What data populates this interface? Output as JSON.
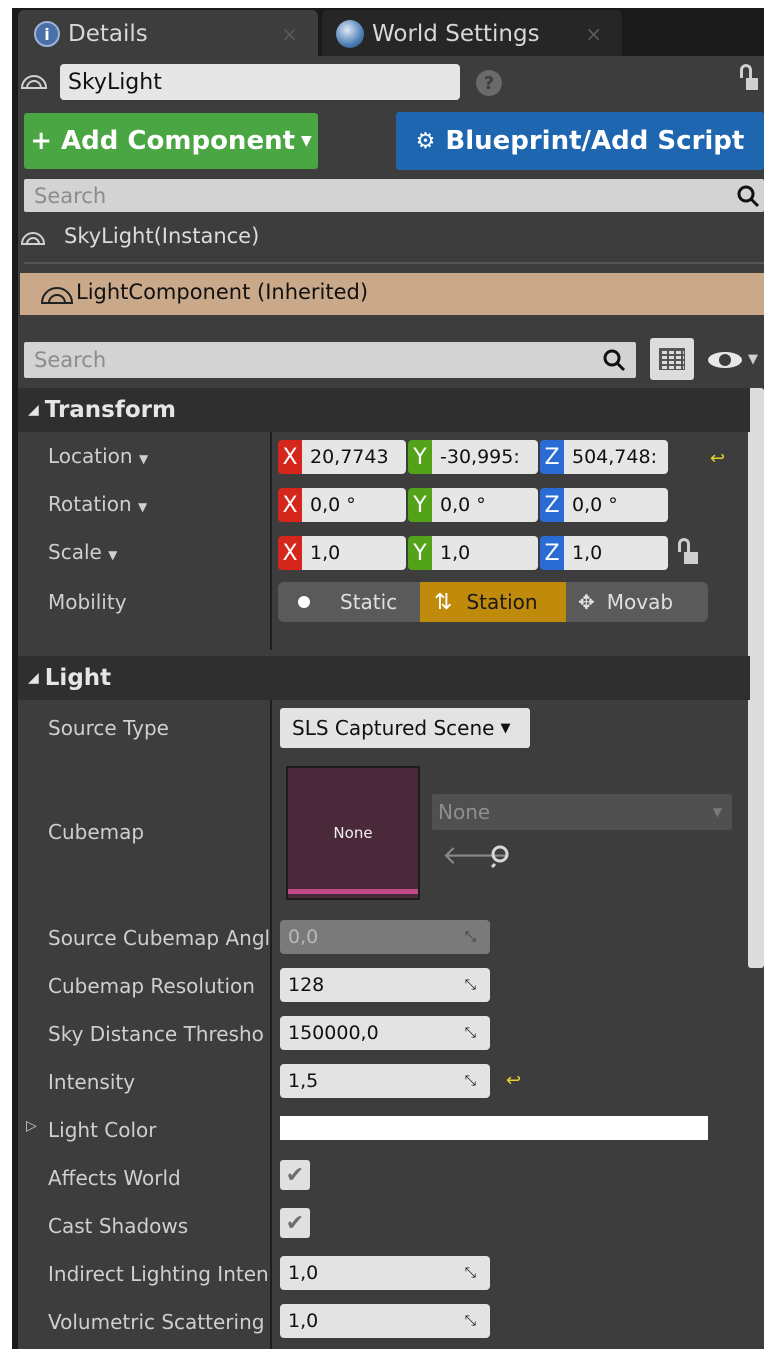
{
  "tabs": [
    {
      "label": "Details",
      "close": "×",
      "icon": "info-icon"
    },
    {
      "label": "World Settings",
      "close": "×",
      "icon": "globe-icon"
    }
  ],
  "actor": {
    "name": "SkyLight",
    "help": "?"
  },
  "buttons": {
    "add_component": "+ Add Component",
    "blueprint": "Blueprint/Add Script"
  },
  "component_search": {
    "placeholder": "Search"
  },
  "components": [
    {
      "label": "SkyLight(Instance)"
    },
    {
      "label": "LightComponent (Inherited)"
    }
  ],
  "details_search": {
    "placeholder": "Search"
  },
  "transform": {
    "header": "Transform",
    "location": {
      "label": "Location",
      "x": "20,7743",
      "y": "-30,995:",
      "z": "504,748:"
    },
    "rotation": {
      "label": "Rotation",
      "x": "0,0 °",
      "y": "0,0 °",
      "z": "0,0 °"
    },
    "scale": {
      "label": "Scale",
      "x": "1,0",
      "y": "1,0",
      "z": "1,0"
    },
    "mobility": {
      "label": "Mobility",
      "options": [
        "Static",
        "Station",
        "Movab"
      ],
      "selected": "Station"
    }
  },
  "light": {
    "header": "Light",
    "source_type": {
      "label": "Source Type",
      "value": "SLS Captured Scene"
    },
    "cubemap": {
      "label": "Cubemap",
      "thumb": "None",
      "asset": "None"
    },
    "props": [
      {
        "label": "Source Cubemap Angl",
        "value": "0,0"
      },
      {
        "label": "Cubemap Resolution",
        "value": "128"
      },
      {
        "label": "Sky Distance Thresho",
        "value": "150000,0"
      },
      {
        "label": "Intensity",
        "value": "1,5"
      },
      {
        "label": "Light Color",
        "value": ""
      },
      {
        "label": "Affects World",
        "value": "✔"
      },
      {
        "label": "Cast Shadows",
        "value": "✔"
      },
      {
        "label": "Indirect Lighting Inten:",
        "value": "1,0"
      },
      {
        "label": "Volumetric Scattering",
        "value": "1,0"
      }
    ]
  },
  "colors": {
    "accent_green": "#4aa543",
    "accent_blue": "#1f66b0",
    "selected_row": "#c9a98a",
    "mobility_selected": "#c08a0a"
  }
}
